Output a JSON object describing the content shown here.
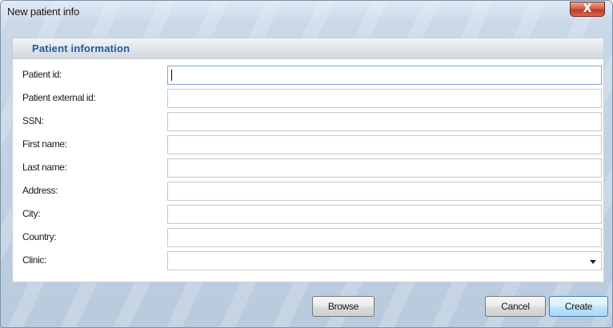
{
  "window": {
    "title": "New patient info",
    "close_glyph": "X"
  },
  "panel": {
    "title": "Patient information"
  },
  "fields": [
    {
      "label": "Patient id:",
      "value": "",
      "placeholder": ""
    },
    {
      "label": "Patient external id:",
      "value": "",
      "placeholder": ""
    },
    {
      "label": "SSN:",
      "value": "",
      "placeholder": ""
    },
    {
      "label": "First name:",
      "value": "",
      "placeholder": ""
    },
    {
      "label": "Last name:",
      "value": "",
      "placeholder": ""
    },
    {
      "label": "Address:",
      "value": "",
      "placeholder": ""
    },
    {
      "label": "City:",
      "value": "",
      "placeholder": ""
    },
    {
      "label": "Country:",
      "value": "",
      "placeholder": ""
    }
  ],
  "clinic": {
    "label": "Clinic:",
    "selected": "",
    "icon": "chevron-down-icon"
  },
  "buttons": {
    "browse": "Browse",
    "cancel": "Cancel",
    "create": "Create"
  },
  "colors": {
    "panel_title": "#1f5b9e",
    "close_button": "#c0392b",
    "default_button_border": "#3c7fb1"
  }
}
